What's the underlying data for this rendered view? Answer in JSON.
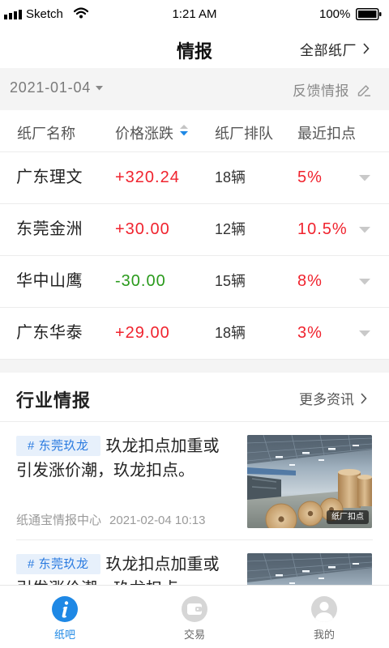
{
  "status_bar": {
    "carrier": "Sketch",
    "time": "1:21 AM",
    "battery": "100%",
    "icons": [
      "signal-icon",
      "wifi-icon",
      "battery-icon"
    ]
  },
  "nav": {
    "title": "情报",
    "right_link": "全部纸厂",
    "right_icon": "chevron-right-icon"
  },
  "filter": {
    "date": "2021-01-04",
    "date_icon": "caret-down-icon",
    "feedback": "反馈情报",
    "feedback_icon": "edit-icon"
  },
  "table": {
    "headers": [
      "纸厂名称",
      "价格涨跌",
      "纸厂排队",
      "最近扣点"
    ],
    "sort_icon": "sort-icon",
    "rows": [
      {
        "name": "广东理文",
        "change": "+320.24",
        "trend": "up",
        "queue": "18辆",
        "deduction": "5%"
      },
      {
        "name": "东莞金洲",
        "change": "+30.00",
        "trend": "up",
        "queue": "12辆",
        "deduction": "10.5%"
      },
      {
        "name": "华中山鹰",
        "change": "-30.00",
        "trend": "down",
        "queue": "15辆",
        "deduction": "8%"
      },
      {
        "name": "广东华泰",
        "change": "+29.00",
        "trend": "up",
        "queue": "18辆",
        "deduction": "3%"
      }
    ]
  },
  "section": {
    "title": "行业情报",
    "more": "更多资讯"
  },
  "news": [
    {
      "tag": "# 东莞玖龙",
      "headline": "玖龙扣点加重或引发涨价潮，玖龙扣点。",
      "source": "纸通宝情报中心",
      "time": "2021-02-04 10:13",
      "image_label": "纸厂扣点"
    },
    {
      "tag": "# 东莞玖龙",
      "headline": "玖龙扣点加重或引发涨价潮，玖龙扣点。"
    }
  ],
  "tab_bar": {
    "items": [
      {
        "label": "纸吧",
        "icon": "info-icon",
        "active": true
      },
      {
        "label": "交易",
        "icon": "wallet-icon",
        "active": false
      },
      {
        "label": "我的",
        "icon": "user-icon",
        "active": false
      }
    ]
  },
  "colors": {
    "accent": "#1e88e5",
    "up": "#f0232e",
    "down": "#2a9a1c",
    "deduction": "#f0232e",
    "tag_bg": "#e7f0fb",
    "tag_text": "#2b7be0"
  }
}
